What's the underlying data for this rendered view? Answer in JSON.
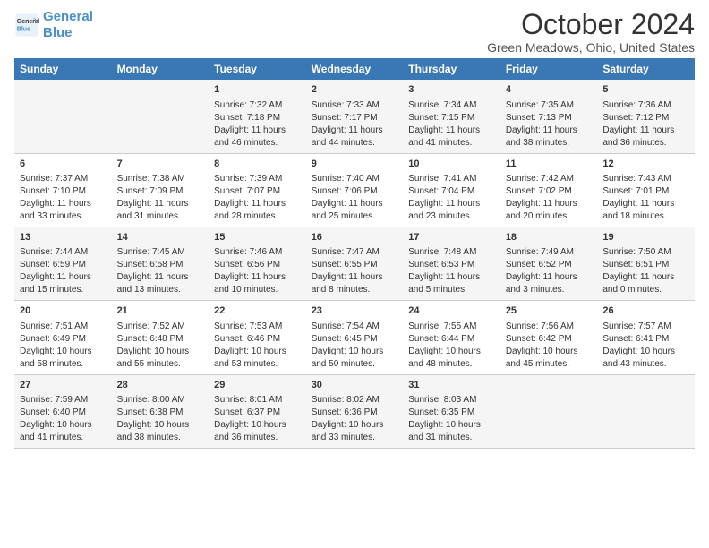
{
  "header": {
    "logo_line1": "General",
    "logo_line2": "Blue",
    "title": "October 2024",
    "subtitle": "Green Meadows, Ohio, United States"
  },
  "columns": [
    "Sunday",
    "Monday",
    "Tuesday",
    "Wednesday",
    "Thursday",
    "Friday",
    "Saturday"
  ],
  "weeks": [
    [
      {
        "day": "",
        "info": ""
      },
      {
        "day": "",
        "info": ""
      },
      {
        "day": "1",
        "info": "Sunrise: 7:32 AM\nSunset: 7:18 PM\nDaylight: 11 hours and 46 minutes."
      },
      {
        "day": "2",
        "info": "Sunrise: 7:33 AM\nSunset: 7:17 PM\nDaylight: 11 hours and 44 minutes."
      },
      {
        "day": "3",
        "info": "Sunrise: 7:34 AM\nSunset: 7:15 PM\nDaylight: 11 hours and 41 minutes."
      },
      {
        "day": "4",
        "info": "Sunrise: 7:35 AM\nSunset: 7:13 PM\nDaylight: 11 hours and 38 minutes."
      },
      {
        "day": "5",
        "info": "Sunrise: 7:36 AM\nSunset: 7:12 PM\nDaylight: 11 hours and 36 minutes."
      }
    ],
    [
      {
        "day": "6",
        "info": "Sunrise: 7:37 AM\nSunset: 7:10 PM\nDaylight: 11 hours and 33 minutes."
      },
      {
        "day": "7",
        "info": "Sunrise: 7:38 AM\nSunset: 7:09 PM\nDaylight: 11 hours and 31 minutes."
      },
      {
        "day": "8",
        "info": "Sunrise: 7:39 AM\nSunset: 7:07 PM\nDaylight: 11 hours and 28 minutes."
      },
      {
        "day": "9",
        "info": "Sunrise: 7:40 AM\nSunset: 7:06 PM\nDaylight: 11 hours and 25 minutes."
      },
      {
        "day": "10",
        "info": "Sunrise: 7:41 AM\nSunset: 7:04 PM\nDaylight: 11 hours and 23 minutes."
      },
      {
        "day": "11",
        "info": "Sunrise: 7:42 AM\nSunset: 7:02 PM\nDaylight: 11 hours and 20 minutes."
      },
      {
        "day": "12",
        "info": "Sunrise: 7:43 AM\nSunset: 7:01 PM\nDaylight: 11 hours and 18 minutes."
      }
    ],
    [
      {
        "day": "13",
        "info": "Sunrise: 7:44 AM\nSunset: 6:59 PM\nDaylight: 11 hours and 15 minutes."
      },
      {
        "day": "14",
        "info": "Sunrise: 7:45 AM\nSunset: 6:58 PM\nDaylight: 11 hours and 13 minutes."
      },
      {
        "day": "15",
        "info": "Sunrise: 7:46 AM\nSunset: 6:56 PM\nDaylight: 11 hours and 10 minutes."
      },
      {
        "day": "16",
        "info": "Sunrise: 7:47 AM\nSunset: 6:55 PM\nDaylight: 11 hours and 8 minutes."
      },
      {
        "day": "17",
        "info": "Sunrise: 7:48 AM\nSunset: 6:53 PM\nDaylight: 11 hours and 5 minutes."
      },
      {
        "day": "18",
        "info": "Sunrise: 7:49 AM\nSunset: 6:52 PM\nDaylight: 11 hours and 3 minutes."
      },
      {
        "day": "19",
        "info": "Sunrise: 7:50 AM\nSunset: 6:51 PM\nDaylight: 11 hours and 0 minutes."
      }
    ],
    [
      {
        "day": "20",
        "info": "Sunrise: 7:51 AM\nSunset: 6:49 PM\nDaylight: 10 hours and 58 minutes."
      },
      {
        "day": "21",
        "info": "Sunrise: 7:52 AM\nSunset: 6:48 PM\nDaylight: 10 hours and 55 minutes."
      },
      {
        "day": "22",
        "info": "Sunrise: 7:53 AM\nSunset: 6:46 PM\nDaylight: 10 hours and 53 minutes."
      },
      {
        "day": "23",
        "info": "Sunrise: 7:54 AM\nSunset: 6:45 PM\nDaylight: 10 hours and 50 minutes."
      },
      {
        "day": "24",
        "info": "Sunrise: 7:55 AM\nSunset: 6:44 PM\nDaylight: 10 hours and 48 minutes."
      },
      {
        "day": "25",
        "info": "Sunrise: 7:56 AM\nSunset: 6:42 PM\nDaylight: 10 hours and 45 minutes."
      },
      {
        "day": "26",
        "info": "Sunrise: 7:57 AM\nSunset: 6:41 PM\nDaylight: 10 hours and 43 minutes."
      }
    ],
    [
      {
        "day": "27",
        "info": "Sunrise: 7:59 AM\nSunset: 6:40 PM\nDaylight: 10 hours and 41 minutes."
      },
      {
        "day": "28",
        "info": "Sunrise: 8:00 AM\nSunset: 6:38 PM\nDaylight: 10 hours and 38 minutes."
      },
      {
        "day": "29",
        "info": "Sunrise: 8:01 AM\nSunset: 6:37 PM\nDaylight: 10 hours and 36 minutes."
      },
      {
        "day": "30",
        "info": "Sunrise: 8:02 AM\nSunset: 6:36 PM\nDaylight: 10 hours and 33 minutes."
      },
      {
        "day": "31",
        "info": "Sunrise: 8:03 AM\nSunset: 6:35 PM\nDaylight: 10 hours and 31 minutes."
      },
      {
        "day": "",
        "info": ""
      },
      {
        "day": "",
        "info": ""
      }
    ]
  ]
}
